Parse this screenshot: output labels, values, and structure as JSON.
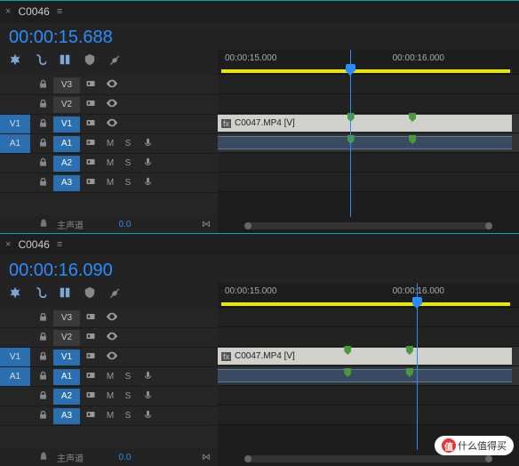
{
  "panels": [
    {
      "tab": "C0046",
      "timecode": "00:00:15.688",
      "ruler": {
        "t1": "00:00:15.000",
        "t2": "00:00:16.000"
      },
      "playhead_pct": 44,
      "markers_pct": [
        44,
        65
      ],
      "clip_label": "C0047.MP4 [V]",
      "tracks": {
        "v3": "V3",
        "v2": "V2",
        "v1src": "V1",
        "v1": "V1",
        "a1src": "A1",
        "a1": "A1",
        "a2": "A2",
        "a3": "A3"
      },
      "footer_label": "主声道",
      "footer_level": "0.0"
    },
    {
      "tab": "C0046",
      "timecode": "00:00:16.090",
      "ruler": {
        "t1": "00:00:15.000",
        "t2": "00:00:16.000"
      },
      "playhead_pct": 66,
      "markers_pct": [
        43,
        64
      ],
      "clip_label": "C0047.MP4 [V]",
      "tracks": {
        "v3": "V3",
        "v2": "V2",
        "v1src": "V1",
        "v1": "V1",
        "a1src": "A1",
        "a1": "A1",
        "a2": "A2",
        "a3": "A3"
      },
      "footer_label": "主声道",
      "footer_level": "0.0"
    }
  ],
  "btn": {
    "m": "M",
    "s": "S"
  },
  "badge": "什么值得买"
}
